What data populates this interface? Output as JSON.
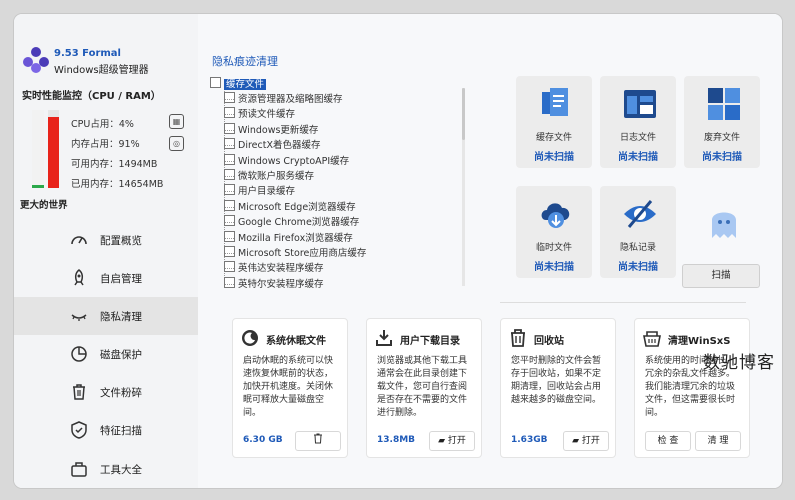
{
  "window": {
    "version": "9.53 Formal",
    "app_name": "Windows超级管理器",
    "controls": [
      "check-circle-icon",
      "minimize-icon",
      "maximize-icon",
      "close-icon"
    ]
  },
  "perf": {
    "title": "实时性能监控（CPU / RAM）",
    "cpu_usage": "CPU占用：4%",
    "mem_usage": "内存占用：91%",
    "available": "可用内存：1494MB",
    "used": "已用内存：14654MB",
    "cpu_percent": 4,
    "ram_percent": 91,
    "world": "更大的世界",
    "cpu_color": "#2ba84a",
    "ram_color": "#e8231a"
  },
  "nav": [
    {
      "label": "配置概览",
      "icon": "gauge-icon"
    },
    {
      "label": "自启管理",
      "icon": "rocket-icon"
    },
    {
      "label": "隐私清理",
      "icon": "eye-closed-icon"
    },
    {
      "label": "磁盘保护",
      "icon": "pie-chart-icon"
    },
    {
      "label": "文件粉碎",
      "icon": "trash-icon"
    },
    {
      "label": "特征扫描",
      "icon": "shield-icon"
    },
    {
      "label": "工具大全",
      "icon": "toolbox-icon"
    }
  ],
  "main": {
    "section_title": "隐私痕迹清理",
    "tree_root": "缓存文件",
    "tree_items": [
      "资源管理器及缩略图缓存",
      "预读文件缓存",
      "Windows更新缓存",
      "DirectX着色器缓存",
      "Windows CryptoAPI缓存",
      "微软账户服务缓存",
      "用户目录缓存",
      "Microsoft Edge浏览器缓存",
      "Google Chrome浏览器缓存",
      "Mozilla Firefox浏览器缓存",
      "Microsoft Store应用商店缓存",
      "英伟达安装程序缓存",
      "英特尔安装程序缓存"
    ],
    "tiles": [
      {
        "name": "缓存文件",
        "status": "尚未扫描",
        "icon": "file-copy-icon"
      },
      {
        "name": "日志文件",
        "status": "尚未扫描",
        "icon": "log-window-icon"
      },
      {
        "name": "废弃文件",
        "status": "尚未扫描",
        "icon": "grid-tiles-icon"
      },
      {
        "name": "临时文件",
        "status": "尚未扫描",
        "icon": "cloud-download-icon"
      },
      {
        "name": "隐私记录",
        "status": "尚未扫描",
        "icon": "eye-slash-icon"
      },
      {
        "name": "",
        "status": "",
        "icon": "ghost-icon"
      }
    ],
    "scan_button": "扫描"
  },
  "cards": [
    {
      "title": "系统休眠文件",
      "icon": "sleep-icon",
      "desc": "启动休眠的系统可以快速恢复休眠前的状态，加快开机速度。关闭休眠可释放大量磁盘空间。",
      "size": "6.30 GB",
      "btn1": "",
      "btn1_icon": "trash-icon"
    },
    {
      "title": "用户下载目录",
      "icon": "download-icon",
      "desc": "浏览器或其他下载工具通常会在此目录创建下载文件，您可自行查阅是否存在不需要的文件进行删除。",
      "size": "13.8MB",
      "btn1": "打开",
      "btn1_icon": "folder-icon"
    },
    {
      "title": "回收站",
      "icon": "recycle-bin-icon",
      "desc": "您平时删除的文件会暂存于回收站，如果不定期清理，回收站会占用越来越多的磁盘空间。",
      "size": "1.63GB",
      "btn1": "打开",
      "btn1_icon": "folder-icon"
    },
    {
      "title": "清理WinSxS",
      "icon": "winsxs-icon",
      "desc": "系统使用的时间越长，冗余的杂乱文件越多。我们能清理冗余的垃圾文件，但这需要很长时间。",
      "size": "",
      "btn1": "检 查",
      "btn2": "清 理"
    }
  ],
  "watermark": "数驰博客"
}
